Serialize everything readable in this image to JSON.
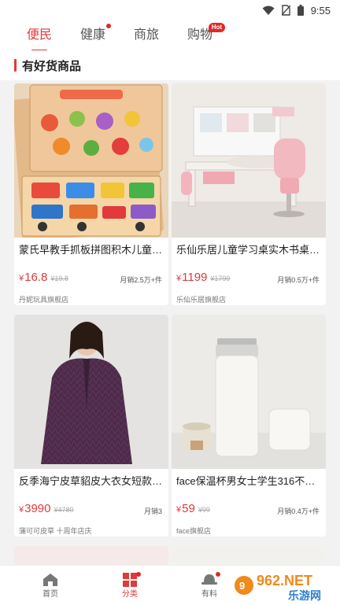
{
  "status": {
    "time": "9:55"
  },
  "tabs": [
    {
      "label": "便民",
      "active": true
    },
    {
      "label": "健康",
      "badge": "dot"
    },
    {
      "label": "商旅"
    },
    {
      "label": "购物",
      "badge": "Hot"
    }
  ],
  "section": {
    "title": "有好货商品"
  },
  "products": [
    {
      "name": "蒙氏早教手抓板拼图积木儿童认...",
      "price": "16.8",
      "currency": "¥",
      "original_price": "¥19.8",
      "sales": "月销2.5万+件",
      "shop": "丹妮玩具旗舰店"
    },
    {
      "name": "乐仙乐居儿童学习桌实木书桌 小...",
      "price": "1199",
      "currency": "¥",
      "original_price": "¥1799",
      "sales": "月销0.5万+件",
      "shop": "乐仙乐居旗舰店"
    },
    {
      "name": "反季海宁皮草貂皮大衣女短款水...",
      "price": "3990",
      "currency": "¥",
      "original_price": "¥4780",
      "sales": "月销3",
      "shop": "蒲可可皮草 十周年店庆"
    },
    {
      "name": "face保温杯男女士学生316不锈...",
      "price": "59",
      "currency": "¥",
      "original_price": "¥99",
      "sales": "月销0.4万+件",
      "shop": "face旗舰店"
    }
  ],
  "bottom_nav": [
    {
      "label": "首页",
      "icon": "home-icon"
    },
    {
      "label": "分类",
      "icon": "category-icon",
      "active": true
    },
    {
      "label": "有料",
      "icon": "hat-icon"
    }
  ],
  "watermark": {
    "text": "962.NET",
    "sub": "乐游网"
  },
  "colors": {
    "accent": "#e03a3a"
  }
}
